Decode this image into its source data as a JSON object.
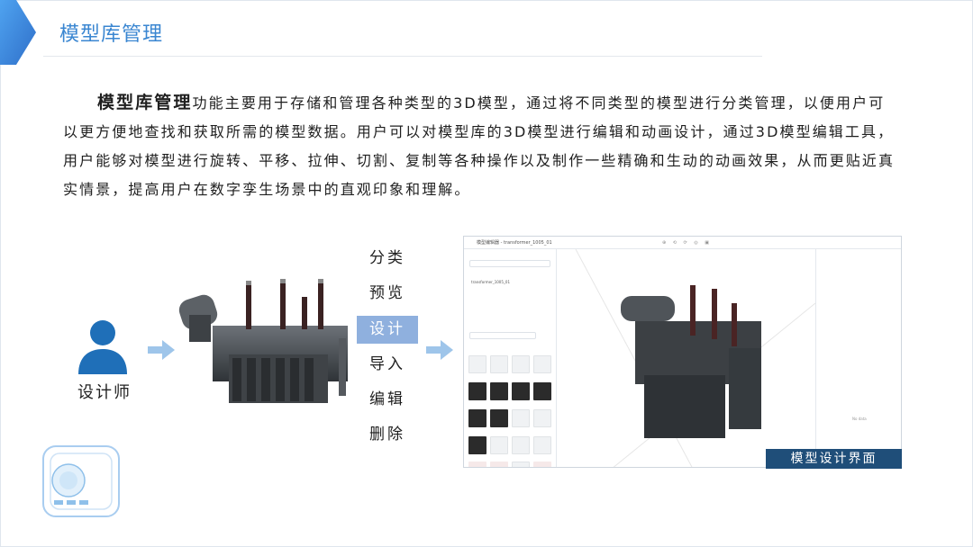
{
  "header": {
    "title": "模型库管理"
  },
  "intro": {
    "lead": "模型库管理",
    "body": "功能主要用于存储和管理各种类型的3D模型，通过将不同类型的模型进行分类管理，以便用户可以更方便地查找和获取所需的模型数据。用户可以对模型库的3D模型进行编辑和动画设计，通过3D模型编辑工具，用户能够对模型进行旋转、平移、拉伸、切割、复制等各种操作以及制作一些精确和生动的动画效果，从而更贴近真实情景，提高用户在数字孪生场景中的直观印象和理解。"
  },
  "designer": {
    "label": "设计师",
    "icon": "person-icon"
  },
  "menu": {
    "items": [
      {
        "label": "分类",
        "active": false
      },
      {
        "label": "预览",
        "active": false
      },
      {
        "label": "设计",
        "active": true
      },
      {
        "label": "导入",
        "active": false
      },
      {
        "label": "编辑",
        "active": false
      },
      {
        "label": "删除",
        "active": false
      }
    ]
  },
  "screenshot": {
    "title": "模型编辑器 - transformer_1005_01",
    "tree_item": "transformer_1005_01",
    "empty_text": "No data",
    "caption": "模型设计界面"
  },
  "colors": {
    "accent": "#3a86d1",
    "menu_active": "#8fb0de",
    "caption_bg": "#1f4e79",
    "arrow": "#9ec5ea"
  }
}
